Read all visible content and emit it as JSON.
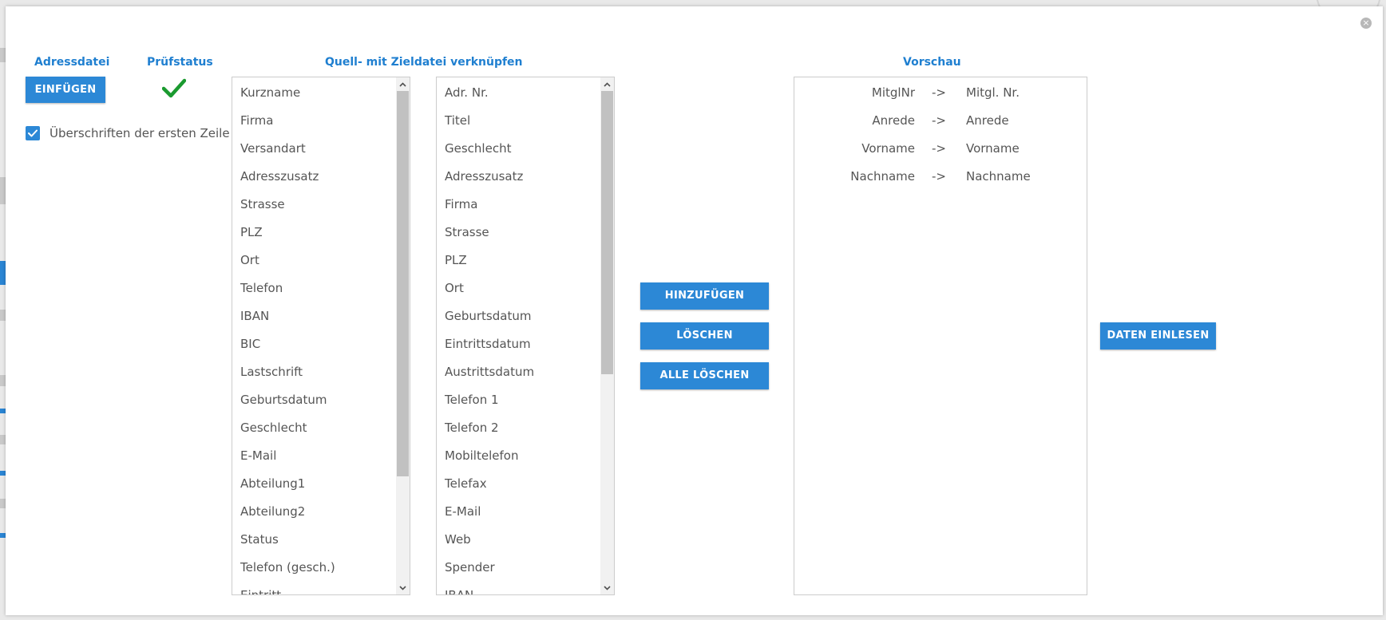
{
  "dialog": {
    "close_symbol": "×"
  },
  "left_panel": {
    "address_file_heading": "Adressdatei",
    "check_status_heading": "Prüfstatus",
    "insert_button": "EINFÜGEN",
    "status_icon": "checkmark-icon",
    "header_checkbox": {
      "label": "Überschriften der ersten Zeile",
      "checked": true
    }
  },
  "mapping": {
    "heading": "Quell- mit Zieldatei verknüpfen",
    "source_fields": [
      "Kurzname",
      "Firma",
      "Versandart",
      "Adresszusatz",
      "Strasse",
      "PLZ",
      "Ort",
      "Telefon",
      "IBAN",
      "BIC",
      "Lastschrift",
      "Geburtsdatum",
      "Geschlecht",
      "E-Mail",
      "Abteilung1",
      "Abteilung2",
      "Status",
      "Telefon (gesch.)",
      "Eintritt"
    ],
    "target_fields": [
      "Adr. Nr.",
      "Titel",
      "Geschlecht",
      "Adresszusatz",
      "Firma",
      "Strasse",
      "PLZ",
      "Ort",
      "Geburtsdatum",
      "Eintrittsdatum",
      "Austrittsdatum",
      "Telefon 1",
      "Telefon 2",
      "Mobiltelefon",
      "Telefax",
      "E-Mail",
      "Web",
      "Spender",
      "IBAN"
    ]
  },
  "actions": {
    "add_button": "HINZUFÜGEN",
    "delete_button": "LÖSCHEN",
    "delete_all_button": "ALLE LÖSCHEN"
  },
  "preview": {
    "heading": "Vorschau",
    "arrow": "->",
    "mappings": [
      {
        "source": "MitglNr",
        "target": "Mitgl. Nr."
      },
      {
        "source": "Anrede",
        "target": "Anrede"
      },
      {
        "source": "Vorname",
        "target": "Vorname"
      },
      {
        "source": "Nachname",
        "target": "Nachname"
      }
    ]
  },
  "import_button": "DATEN EINLESEN",
  "colors": {
    "accent": "#2c88d6",
    "heading": "#1f7fd0",
    "check_green": "#1a9a2f",
    "text": "#555555"
  }
}
